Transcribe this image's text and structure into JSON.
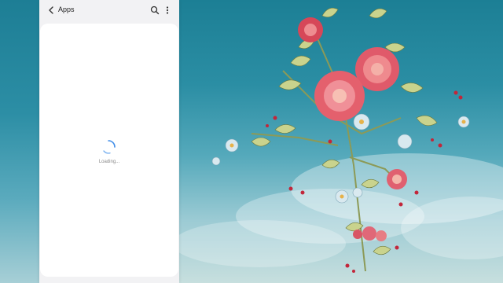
{
  "appbar": {
    "title": "Apps",
    "back_icon": "chevron-left-icon",
    "search_icon": "search-icon",
    "more_icon": "more-vertical-icon"
  },
  "content": {
    "loading_text": "Loading..."
  },
  "colors": {
    "panel_background": "#f2f2f4",
    "card_background": "#ffffff",
    "spinner_accent": "#3f8ce8",
    "sky_top": "#1c7f95",
    "sky_bottom": "#c7dfde"
  }
}
